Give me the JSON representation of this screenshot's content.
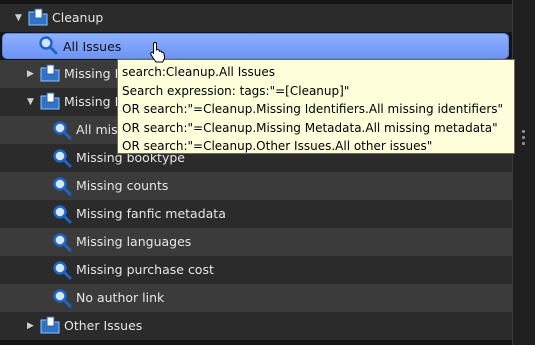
{
  "tree": {
    "cleanup": "Cleanup",
    "all_issues": "All Issues",
    "missing_identifiers": "Missing I",
    "missing_metadata": "Missing M",
    "all_missing": "All mis",
    "items": [
      "Missing booktype",
      "Missing counts",
      "Missing fanfic metadata",
      "Missing languages",
      "Missing purchase cost",
      "No author link"
    ],
    "other_issues": "Other Issues"
  },
  "tooltip": {
    "lines": [
      "search:Cleanup.All Issues",
      "Search expression: tags:\"=[Cleanup]\"",
      "OR search:\"=Cleanup.Missing Identifiers.All missing identifiers\"",
      "OR search:\"=Cleanup.Missing Metadata.All missing metadata\"",
      "OR search:\"=Cleanup.Other Issues.All other issues\""
    ]
  },
  "icons": {
    "folder": "folder-search-icon",
    "search": "magnifier-icon",
    "expand": "triangle-icon"
  }
}
